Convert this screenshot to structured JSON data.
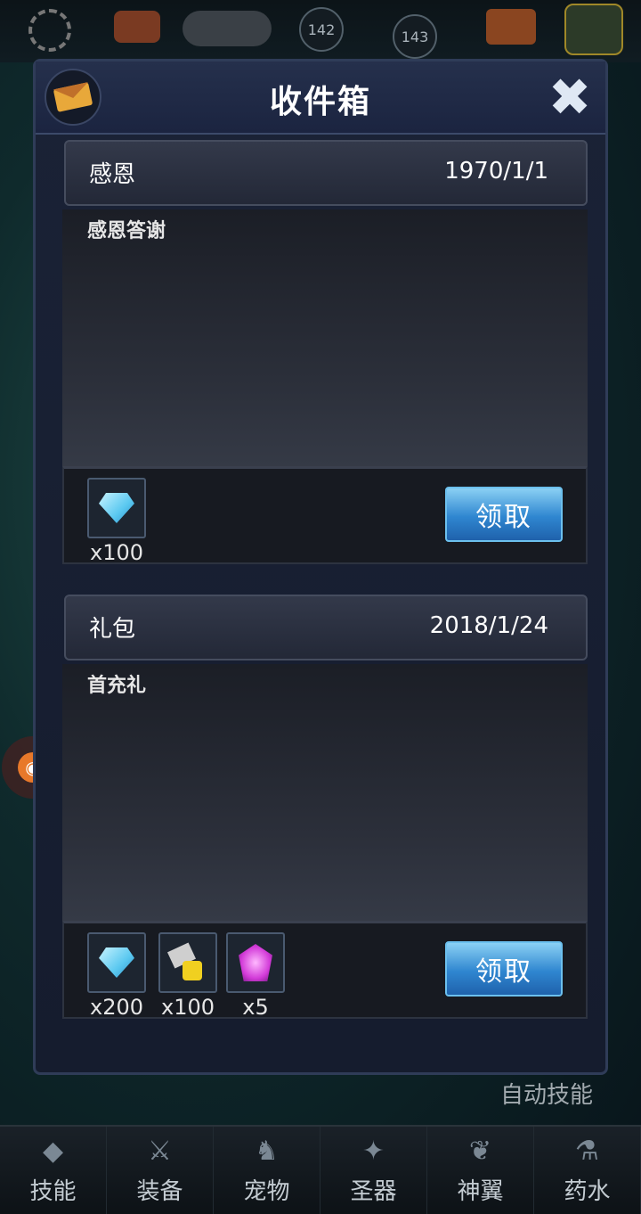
{
  "top_bar": {
    "badges": [
      "142",
      "143"
    ]
  },
  "inbox": {
    "title": "收件箱",
    "mails": [
      {
        "subject": "感恩",
        "date": "1970/1/1",
        "body": "感恩答谢",
        "rewards": [
          {
            "icon": "diamond-icon",
            "qty": "x100"
          }
        ],
        "claim_label": "领取"
      },
      {
        "subject": "礼包",
        "date": "2018/1/24",
        "body": "首充礼",
        "rewards": [
          {
            "icon": "diamond-icon",
            "qty": "x200"
          },
          {
            "icon": "puzzle-piece-icon",
            "qty": "x100"
          },
          {
            "icon": "purple-gem-icon",
            "qty": "x5"
          }
        ],
        "claim_label": "领取"
      }
    ]
  },
  "auto_skill_label": "自动技能",
  "bottom_nav": [
    {
      "label": "技能",
      "icon": "skill-icon"
    },
    {
      "label": "装备",
      "icon": "sword-icon"
    },
    {
      "label": "宠物",
      "icon": "pet-icon"
    },
    {
      "label": "圣器",
      "icon": "artifact-icon"
    },
    {
      "label": "神翼",
      "icon": "wings-icon"
    },
    {
      "label": "药水",
      "icon": "potion-icon"
    }
  ]
}
